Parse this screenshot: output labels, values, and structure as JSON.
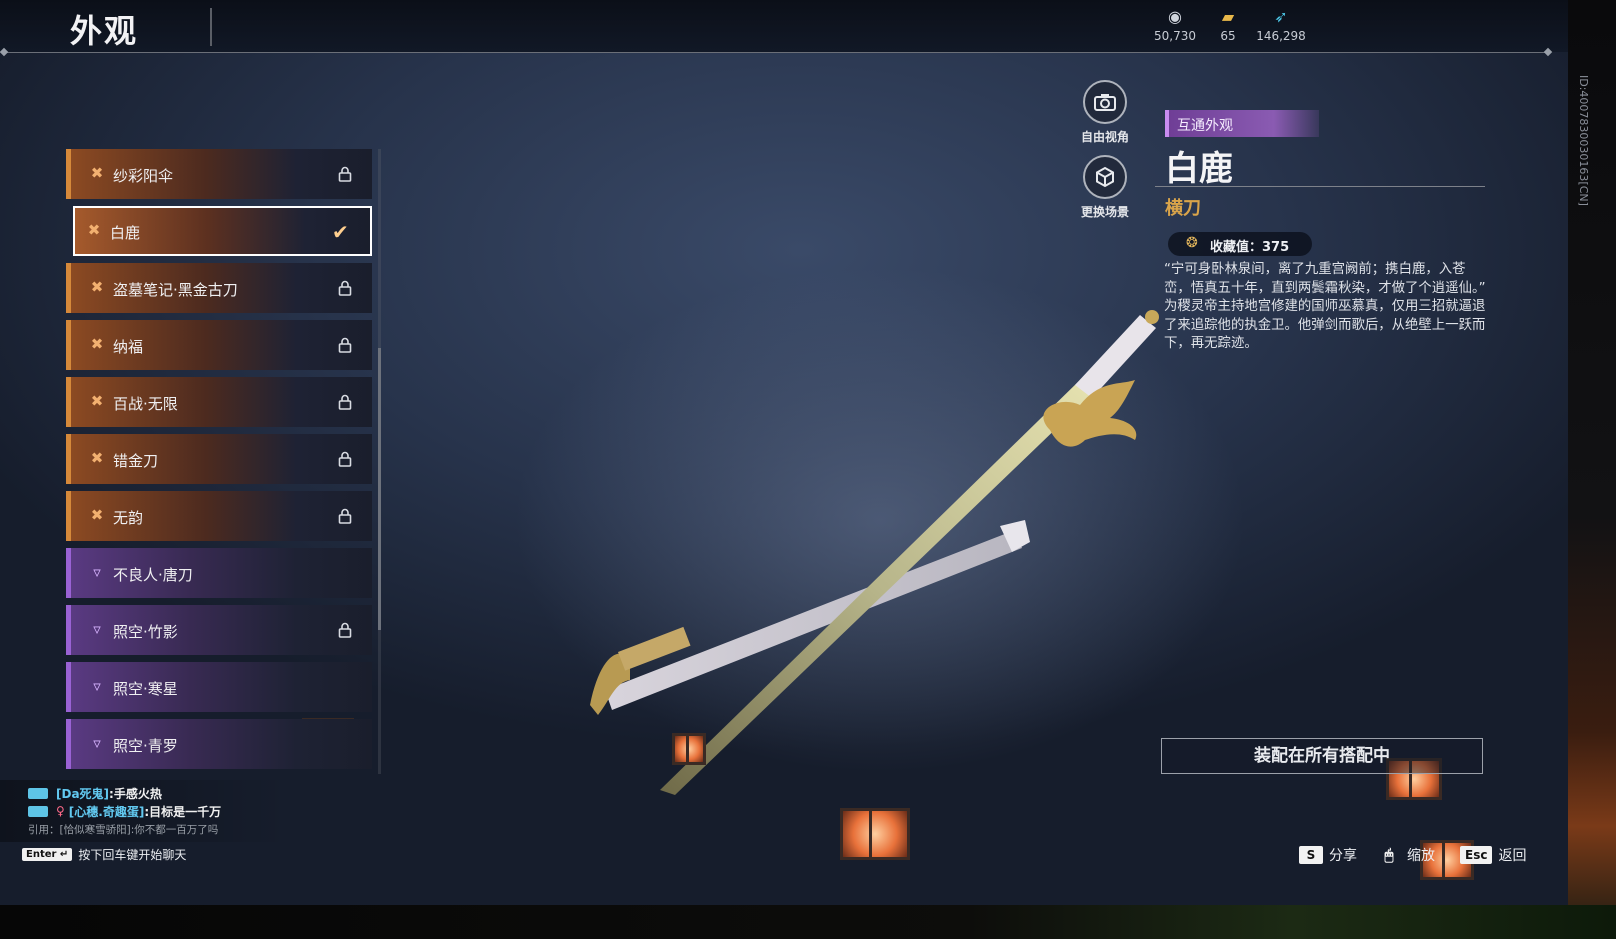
{
  "page_title": "外观",
  "currencies": [
    {
      "icon": "coin-icon",
      "value": "50,730"
    },
    {
      "icon": "ticket-icon",
      "value": "65"
    },
    {
      "icon": "feather-icon",
      "value": "146,298"
    }
  ],
  "id_watermark": "ID:4007830030163[CN]",
  "appearance_list": [
    {
      "name": "纱彩阳伞",
      "quality": "orange",
      "status": "locked"
    },
    {
      "name": "白鹿",
      "quality": "orange",
      "status": "selected"
    },
    {
      "name": "盗墓笔记·黑金古刀",
      "quality": "orange",
      "status": "locked"
    },
    {
      "name": "纳福",
      "quality": "orange",
      "status": "locked"
    },
    {
      "name": "百战·无限",
      "quality": "orange",
      "status": "locked"
    },
    {
      "name": "错金刀",
      "quality": "orange",
      "status": "locked"
    },
    {
      "name": "无韵",
      "quality": "orange",
      "status": "locked"
    },
    {
      "name": "不良人·唐刀",
      "quality": "purple",
      "status": "owned"
    },
    {
      "name": "照空·竹影",
      "quality": "purple",
      "status": "locked"
    },
    {
      "name": "照空·寒星",
      "quality": "purple",
      "status": "owned"
    },
    {
      "name": "照空·青罗",
      "quality": "purple",
      "status": "owned"
    }
  ],
  "camera_buttons": {
    "free_view": "自由视角",
    "change_scene": "更换场景"
  },
  "detail": {
    "tag": "互通外观",
    "name": "白鹿",
    "type": "横刀",
    "collection_label": "收藏值：375",
    "quote": "“宁可身卧林泉间，离了九重宫阙前；携白鹿，入苍峦，悟真五十年，直到两鬓霜秋染，才做了个逍遥仙。”",
    "lore": "为稷灵帝主持地宫修建的国师巫慕真，仅用三招就逼退了来追踪他的执金卫。他弹剑而歌后，从绝壁上一跃而下，再无踪迹。"
  },
  "equip_button": "装配在所有搭配中",
  "footer_hints": [
    {
      "key": "S",
      "label": "分享"
    },
    {
      "key": "🖱",
      "label": "缩放"
    },
    {
      "key": "Esc",
      "label": "返回"
    }
  ],
  "chat": {
    "lines": [
      {
        "user": "[Da死鬼]",
        "msg": ":手感火热"
      },
      {
        "user": "[心穗.奇趣蛋]",
        "msg": ":目标是一千万"
      }
    ],
    "quote_line": "引用：[恰似寒雪骄阳]:你不都一百万了吗",
    "input_key": "Enter ↵",
    "input_hint": "按下回车键开始聊天"
  },
  "colors": {
    "orange_quality": "#d6893a",
    "purple_quality": "#9a62d4",
    "type_gold": "#d9a44a",
    "chat_user": "#62c9f0"
  }
}
